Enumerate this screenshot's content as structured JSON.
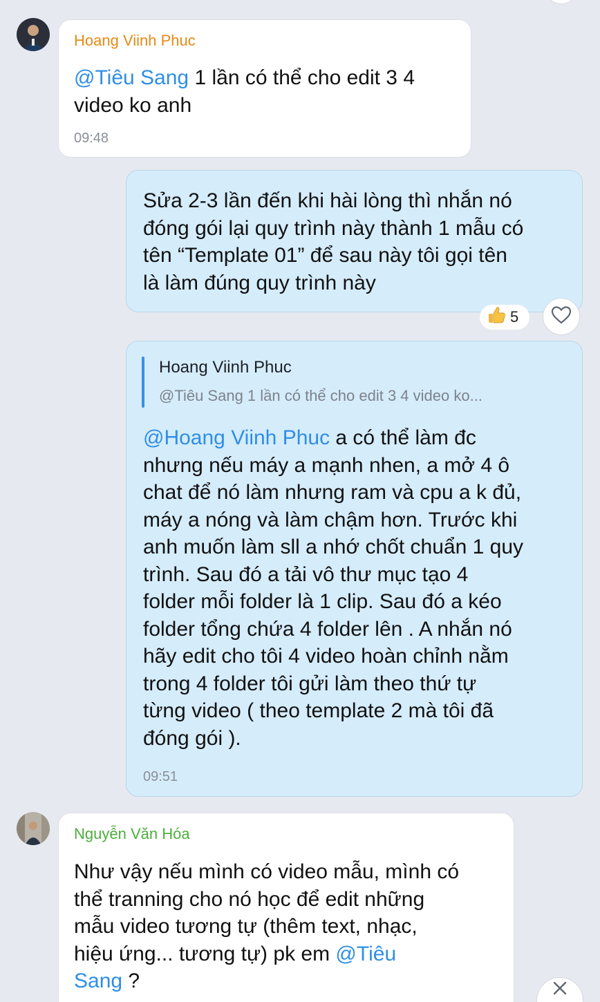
{
  "messages": [
    {
      "sender": "Hoang Viinh Phuc",
      "sender_color": "#e58a16",
      "mention": "@Tiêu Sang",
      "text": " 1 lần có thể cho edit 3 4 video ko anh",
      "time": "09:48"
    },
    {
      "text_lines": [
        "Sửa 2-3 lần đến khi hài lòng thì nhắn nó",
        "đóng gói lại quy trình này thành 1 mẫu có",
        "tên “Template 01” để sau này tôi gọi tên",
        "là làm đúng quy trình này"
      ],
      "reaction_icon": "thumbs-up",
      "reaction_count": "5"
    },
    {
      "reply_to": {
        "name": "Hoang Viinh Phuc",
        "preview": "@Tiêu Sang 1 lần có thể cho edit 3 4 video ko..."
      },
      "mention": "@Hoang Viinh Phuc",
      "first_line_rest": " a có thể làm đc",
      "lines": [
        "nhưng nếu máy a mạnh nhen, a mở 4 ô",
        "chat để nó làm nhưng ram và cpu a k đủ,",
        "máy a nóng và làm chậm hơn. Trước khi",
        "anh muốn làm sll a nhớ chốt chuẩn 1 quy",
        "trình. Sau đó a tải vô thư mục tạo 4",
        "folder mỗi folder là 1 clip. Sau đó a kéo",
        "folder tổng chứa 4 folder lên . A nhắn nó",
        "hãy edit cho tôi 4 video hoàn chỉnh nằm",
        "trong 4 folder tôi gửi làm theo thứ tự",
        "từng video ( theo template 2 mà tôi đã",
        "đóng gói )."
      ],
      "time": "09:51"
    },
    {
      "sender": "Nguyễn Văn Hóa",
      "sender_color": "#4cae3c",
      "lines": [
        "Như vậy nếu mình có video mẫu, mình có",
        "thể tranning cho nó học để edit những",
        "mẫu video tương tự (thêm text, nhạc,"
      ],
      "line4_text": "hiệu ứng... tương tự) pk em ",
      "line4_mention": "@Tiêu",
      "line5_mention": "Sang",
      "line5_text": " ?"
    }
  ]
}
